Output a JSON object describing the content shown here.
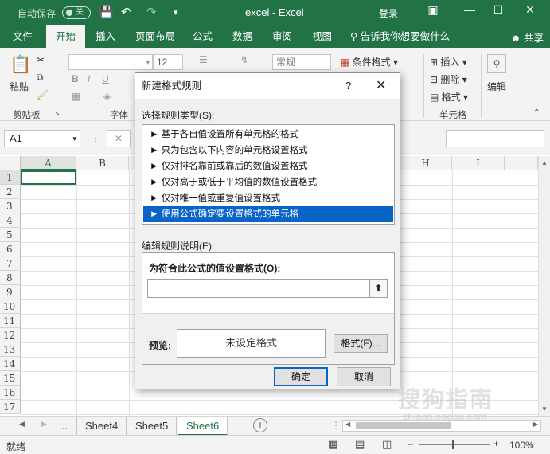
{
  "titlebar": {
    "autosave_label": "自动保存",
    "autosave_state": "关",
    "app_title": "excel - Excel",
    "login": "登录"
  },
  "menu": {
    "tabs": [
      "文件",
      "开始",
      "插入",
      "页面布局",
      "公式",
      "数据",
      "审阅",
      "视图"
    ],
    "active_tab": "开始",
    "tellme": "告诉我你想要做什么",
    "share": "共享"
  },
  "ribbon": {
    "paste": "粘贴",
    "clipboard": "剪贴板",
    "font_group": "字体",
    "font_size": "12",
    "number_format": "常规",
    "conditional_format": "条件格式",
    "insert": "插入",
    "delete": "删除",
    "format": "格式",
    "cells_group": "单元格",
    "edit": "编辑"
  },
  "formula_bar": {
    "namebox": "A1"
  },
  "grid": {
    "columns": [
      "A",
      "B",
      "H",
      "I"
    ],
    "rows": [
      "1",
      "2",
      "3",
      "4",
      "5",
      "6",
      "7",
      "8",
      "9",
      "10",
      "11",
      "12",
      "13",
      "14",
      "15",
      "16",
      "17"
    ]
  },
  "sheets": {
    "tabs": [
      "Sheet4",
      "Sheet5",
      "Sheet6"
    ],
    "active": "Sheet6",
    "ellipsis": "..."
  },
  "status": {
    "ready": "就绪",
    "zoom": "100%"
  },
  "dialog": {
    "title": "新建格式规则",
    "help": "?",
    "rule_type_label": "选择规则类型(S):",
    "rules": [
      "► 基于各自值设置所有单元格的格式",
      "► 只为包含以下内容的单元格设置格式",
      "► 仅对排名靠前或靠后的数值设置格式",
      "► 仅对高于或低于平均值的数值设置格式",
      "► 仅对唯一值或重复值设置格式",
      "► 使用公式确定要设置格式的单元格"
    ],
    "selected_rule_index": 5,
    "edit_desc_label": "编辑规则说明(E):",
    "formula_label": "为符合此公式的值设置格式(O):",
    "formula_value": "",
    "preview_label": "预览:",
    "preview_text": "未设定格式",
    "format_button": "格式(F)...",
    "ok_button": "确定",
    "cancel_button": "取消"
  },
  "watermark": {
    "text": "搜狗指南",
    "url": "zhinan.sogou.com"
  },
  "colors": {
    "excel_green": "#217346",
    "selection_blue": "#0a64c8"
  }
}
